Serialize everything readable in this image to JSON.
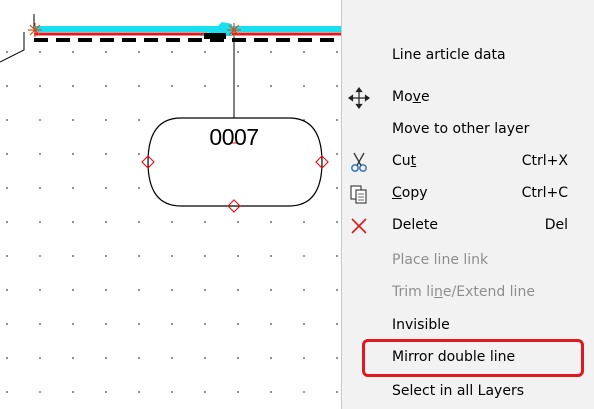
{
  "canvas": {
    "node_label": "0007"
  },
  "context_menu": {
    "items": [
      {
        "label": "Line article data",
        "shortcut": "",
        "icon": "",
        "disabled": false
      },
      {
        "label_parts": [
          "Mo",
          "v",
          "e"
        ],
        "shortcut": "",
        "icon": "move-icon",
        "disabled": false
      },
      {
        "label": "Move to other layer",
        "shortcut": "",
        "icon": "",
        "disabled": false
      },
      {
        "label_parts": [
          "Cu",
          "t",
          ""
        ],
        "shortcut": "Ctrl+X",
        "icon": "scissors-icon",
        "disabled": false
      },
      {
        "label_parts": [
          "",
          "C",
          "opy"
        ],
        "shortcut": "Ctrl+C",
        "icon": "copy-icon",
        "disabled": false
      },
      {
        "label": "Delete",
        "shortcut": "Del",
        "icon": "delete-x-icon",
        "disabled": false
      },
      {
        "label": "Place line link",
        "shortcut": "",
        "icon": "",
        "disabled": true
      },
      {
        "label_parts": [
          "Trim li",
          "n",
          "e/Extend line"
        ],
        "shortcut": "",
        "icon": "",
        "disabled": true
      },
      {
        "label": "Invisible",
        "shortcut": "",
        "icon": "",
        "disabled": false
      },
      {
        "label": "Mirror double line",
        "shortcut": "",
        "icon": "",
        "disabled": false,
        "highlighted": true
      },
      {
        "label": "Select in all Layers",
        "shortcut": "",
        "icon": "",
        "disabled": false
      }
    ]
  },
  "colors": {
    "cyan_line": "#18e0f0",
    "red_line": "#e0181f",
    "highlight_border": "#e0181f",
    "menu_bg": "#f2f2f2"
  }
}
